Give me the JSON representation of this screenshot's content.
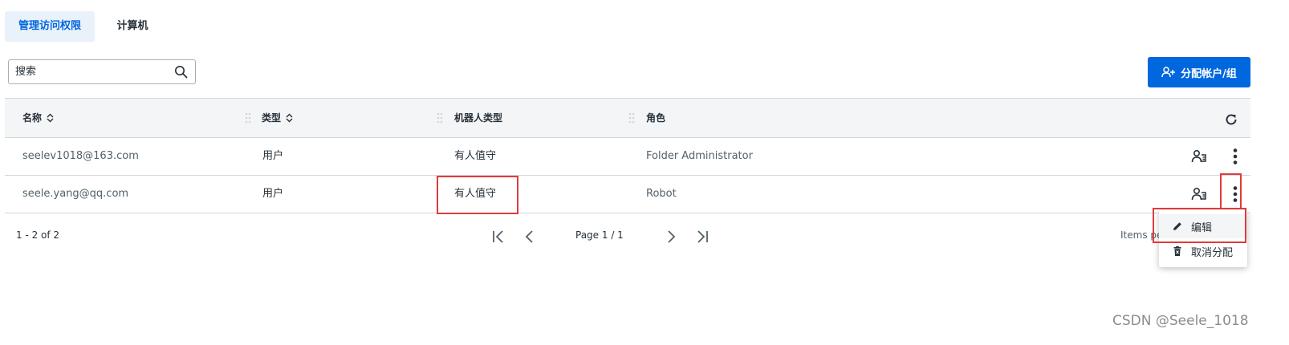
{
  "tabs": [
    {
      "label": "管理访问权限",
      "active": true
    },
    {
      "label": "计算机",
      "active": false
    }
  ],
  "search": {
    "placeholder": "搜索",
    "icon": "search-icon"
  },
  "assign_button": {
    "label": "分配帐户/组",
    "icon": "add-user-icon"
  },
  "grid": {
    "columns": [
      {
        "label": "名称",
        "sortable": true
      },
      {
        "label": "类型",
        "sortable": true
      },
      {
        "label": "机器人类型",
        "sortable": false
      },
      {
        "label": "角色",
        "sortable": false
      }
    ],
    "rows": [
      {
        "name": "seelev1018@163.com",
        "type": "用户",
        "robot_type": "有人值守",
        "role": "Folder Administrator"
      },
      {
        "name": "seele.yang@qq.com",
        "type": "用户",
        "robot_type": "有人值守",
        "role": "Robot"
      }
    ]
  },
  "pager": {
    "range": "1 - 2 of 2",
    "page": "Page 1 / 1",
    "items_per_page_label": "Items pe"
  },
  "context_menu": {
    "items": [
      {
        "label": "编辑",
        "icon": "pencil-icon"
      },
      {
        "label": "取消分配",
        "icon": "trash-icon"
      }
    ]
  },
  "watermark": "CSDN @Seele_1018",
  "colors": {
    "accent": "#0067df",
    "highlight": "#e03b3b"
  }
}
